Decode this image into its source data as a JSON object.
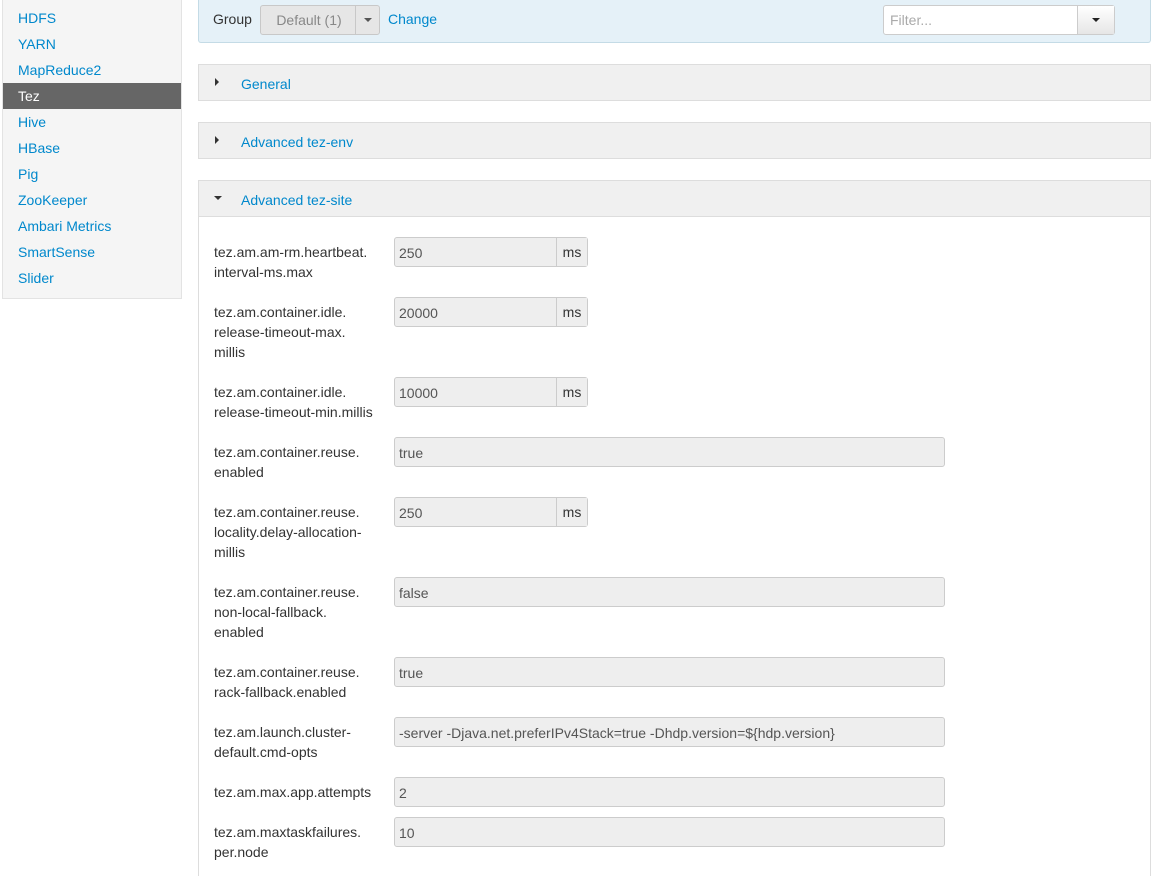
{
  "sidebar": {
    "items": [
      {
        "label": "HDFS"
      },
      {
        "label": "YARN"
      },
      {
        "label": "MapReduce2"
      },
      {
        "label": "Tez"
      },
      {
        "label": "Hive"
      },
      {
        "label": "HBase"
      },
      {
        "label": "Pig"
      },
      {
        "label": "ZooKeeper"
      },
      {
        "label": "Ambari Metrics"
      },
      {
        "label": "SmartSense"
      },
      {
        "label": "Slider"
      }
    ],
    "active": "Tez"
  },
  "toolbar": {
    "group_label": "Group",
    "group_value": "Default (1)",
    "change_label": "Change",
    "filter_placeholder": "Filter..."
  },
  "sections": [
    {
      "title": "General",
      "expanded": false
    },
    {
      "title": "Advanced tez-env",
      "expanded": false
    },
    {
      "title": "Advanced tez-site",
      "expanded": true
    }
  ],
  "configs": [
    {
      "label": "tez.am.am-rm.heartbeat.\ninterval-ms.max",
      "value": "250",
      "unit": "ms"
    },
    {
      "label": "tez.am.container.idle.\nrelease-timeout-max.\nmillis",
      "value": "20000",
      "unit": "ms"
    },
    {
      "label": "tez.am.container.idle.\nrelease-timeout-min.millis",
      "value": "10000",
      "unit": "ms"
    },
    {
      "label": "tez.am.container.reuse.\nenabled",
      "value": "true",
      "unit": ""
    },
    {
      "label": "tez.am.container.reuse.\nlocality.delay-allocation-\nmillis",
      "value": "250",
      "unit": "ms"
    },
    {
      "label": "tez.am.container.reuse.\nnon-local-fallback.\nenabled",
      "value": "false",
      "unit": ""
    },
    {
      "label": "tez.am.container.reuse.\nrack-fallback.enabled",
      "value": "true",
      "unit": ""
    },
    {
      "label": "tez.am.launch.cluster-\ndefault.cmd-opts",
      "value": "-server -Djava.net.preferIPv4Stack=true -Dhdp.version=${hdp.version}",
      "unit": ""
    },
    {
      "label": "tez.am.max.app.attempts",
      "value": "2",
      "unit": ""
    },
    {
      "label": "tez.am.maxtaskfailures.\nper.node",
      "value": "10",
      "unit": ""
    }
  ]
}
